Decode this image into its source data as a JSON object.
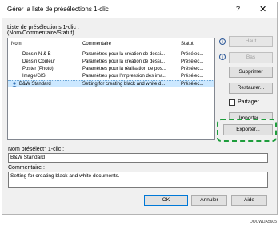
{
  "window": {
    "title": "Gérer la liste de présélections 1-clic",
    "help": "?",
    "close": "✕"
  },
  "list_label_line1": "Liste de présélections 1-clic :",
  "list_label_line2": "(Nom/Commentaire/Statut)",
  "columns": [
    "Nom",
    "Commentaire",
    "Statut"
  ],
  "rows": [
    {
      "name": "Dessin N & B",
      "comment": "Paramètres pour la création de dessi...",
      "status": "Présélec..."
    },
    {
      "name": "Dessin Couleur",
      "comment": "Paramètres pour la création de dessi...",
      "status": "Présélec..."
    },
    {
      "name": "Poster (Photo)",
      "comment": "Paramètres pour la réalisation de pos...",
      "status": "Présélec..."
    },
    {
      "name": "Image/GIS",
      "comment": "Paramètres pour l'impression des ima...",
      "status": "Présélec..."
    },
    {
      "name": "B&W Standard",
      "comment": "Setting for creating black and white d...",
      "status": "Présélec...",
      "selected": true
    }
  ],
  "buttons": {
    "haut": "Haut",
    "bas": "Bas",
    "supprimer": "Supprimer",
    "restaurer": "Restaurer...",
    "importer": "Importer...",
    "exporter": "Exporter...",
    "ok": "OK",
    "annuler": "Annuler",
    "aide": "Aide"
  },
  "partager_label": "Partager",
  "info_glyph": "i",
  "name_label": "Nom présélect° 1-clic :",
  "name_value": "B&W Standard",
  "comment_label": "Commentaire :",
  "comment_value": "Setting for creating black and white documents.",
  "figure_code": "DOCWDA5605",
  "accent_highlight": "#1e9d3c"
}
